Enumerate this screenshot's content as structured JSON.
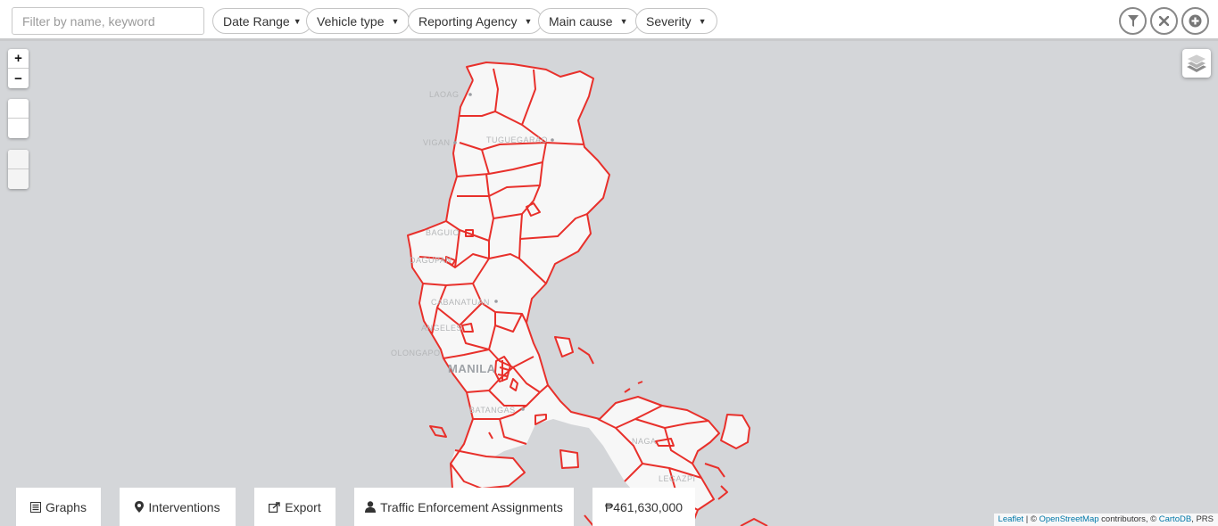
{
  "search": {
    "placeholder": "Filter by name, keyword",
    "value": ""
  },
  "filters": {
    "date_range": "Date Range",
    "vehicle_type": "Vehicle type",
    "reporting_agency": "Reporting Agency",
    "main_cause": "Main cause",
    "severity": "Severity"
  },
  "toolbar_icons": [
    "filter-icon",
    "close-icon",
    "add-circle-icon"
  ],
  "map_controls": {
    "zoom_in": "+",
    "zoom_out": "−",
    "draw_icons": [
      "polygon-icon",
      "rectangle-icon"
    ],
    "edit_icons": [
      "edit-icon",
      "trash-icon"
    ]
  },
  "map_labels": {
    "laoag": "LAOAG",
    "tuguegarao": "TUGUEGARAO",
    "vigan": "VIGAN",
    "baguio": "BAGUIO",
    "dagupan": "DAGUPAN",
    "cabanatuan": "CABANATUAN",
    "angeles": "ANGELES",
    "olongapo": "OLONGAPO",
    "manila": "MANILA",
    "batangas": "BATANGAS",
    "naga": "NAGA",
    "legazpi": "LEGAZPI"
  },
  "colors": {
    "boundary": "#e8302b",
    "land": "#f7f7f7",
    "sea": "#d4d6d9"
  },
  "bottom_bar": {
    "graphs": "Graphs",
    "interventions": "Interventions",
    "export": "Export",
    "traffic_enforcement": "Traffic Enforcement Assignments",
    "total": "₱461,630,000"
  },
  "attribution": {
    "leaflet": "Leaflet",
    "osm_prefix": " | © ",
    "osm": "OpenStreetMap",
    "contrib": " contributors, © ",
    "cartodb": "CartoDB",
    "prs": ", PRS"
  }
}
